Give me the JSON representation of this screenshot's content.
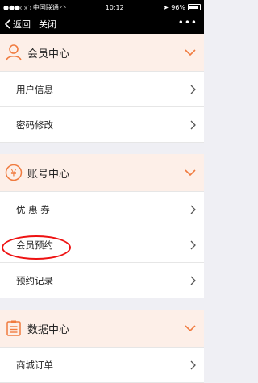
{
  "status_bar": {
    "carrier": "中国联通",
    "time": "10:12",
    "battery": "96%"
  },
  "nav": {
    "back_label": "返回",
    "close_label": "关闭",
    "more": "•••"
  },
  "sections": [
    {
      "title": "会员中心",
      "icon": "person-icon",
      "items": [
        "用户信息",
        "密码修改"
      ]
    },
    {
      "title": "账号中心",
      "icon": "yen-icon",
      "items": [
        "优 惠 券",
        "会员预约",
        "预约记录"
      ]
    },
    {
      "title": "数据中心",
      "icon": "list-icon",
      "items": [
        "商城订单"
      ]
    }
  ],
  "colors": {
    "accent": "#f07b3f",
    "section_bg": "#fdefe8",
    "highlight": "#e11111"
  }
}
